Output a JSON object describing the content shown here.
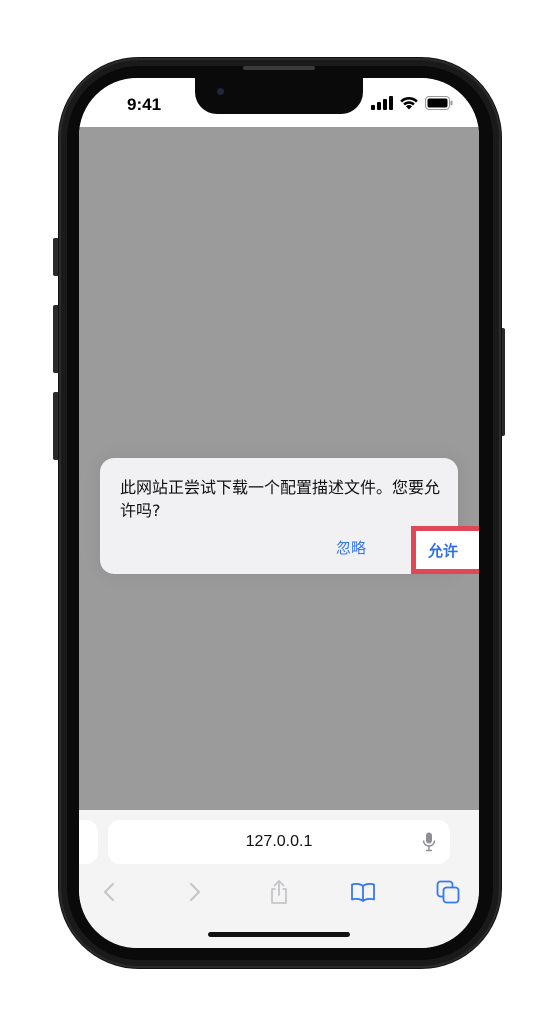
{
  "status_bar": {
    "time": "9:41",
    "icons": [
      "signal-icon",
      "wifi-icon",
      "battery-icon"
    ]
  },
  "alert": {
    "message": "此网站正尝试下载一个配置描述文件。您要允许吗?",
    "ignore_label": "忽略",
    "allow_label": "允许",
    "highlight_color": "#e04855",
    "button_color": "#3478f6"
  },
  "address_bar": {
    "url": "127.0.0.1",
    "icon": "microphone-icon"
  },
  "toolbar": {
    "icons": [
      "back-chevron-icon",
      "forward-chevron-icon",
      "share-icon",
      "bookmarks-book-icon",
      "tabs-icon"
    ]
  },
  "colors": {
    "web_dim": "#9b9b9b",
    "toolbar_bg": "#f4f4f5",
    "accent_blue": "#3478f6"
  }
}
